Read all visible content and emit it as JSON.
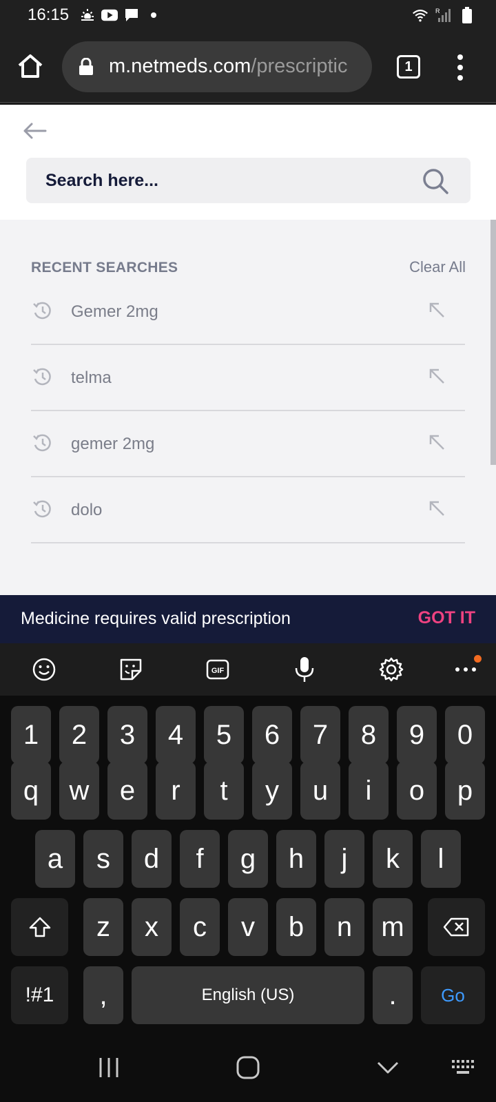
{
  "status_bar": {
    "time": "16:15",
    "left_icons": [
      "weather-icon",
      "youtube-icon",
      "message-icon",
      "dot-icon"
    ],
    "right_icons": [
      "wifi-icon",
      "signal-icon",
      "battery-icon"
    ]
  },
  "browser": {
    "url_domain": "m.netmeds.com",
    "url_path": "/prescriptic",
    "tab_count": "1"
  },
  "search": {
    "placeholder": "Search here..."
  },
  "recent": {
    "title": "RECENT SEARCHES",
    "clear_label": "Clear All",
    "items": [
      {
        "label": "Gemer 2mg"
      },
      {
        "label": "telma"
      },
      {
        "label": "gemer 2mg"
      },
      {
        "label": "dolo"
      }
    ]
  },
  "banner": {
    "text": "Medicine requires valid prescription",
    "action": "GOT IT"
  },
  "keyboard": {
    "number_row": [
      "1",
      "2",
      "3",
      "4",
      "5",
      "6",
      "7",
      "8",
      "9",
      "0"
    ],
    "row1": [
      "q",
      "w",
      "e",
      "r",
      "t",
      "y",
      "u",
      "i",
      "o",
      "p"
    ],
    "row2": [
      "a",
      "s",
      "d",
      "f",
      "g",
      "h",
      "j",
      "k",
      "l"
    ],
    "row3": [
      "z",
      "x",
      "c",
      "v",
      "b",
      "n",
      "m"
    ],
    "symbols_label": "!#1",
    "comma_label": ",",
    "space_label": "English (US)",
    "period_label": ".",
    "go_label": "Go"
  },
  "colors": {
    "brand_dark": "#151b39",
    "brand_pink": "#ef4281",
    "go_blue": "#3e9bff"
  }
}
